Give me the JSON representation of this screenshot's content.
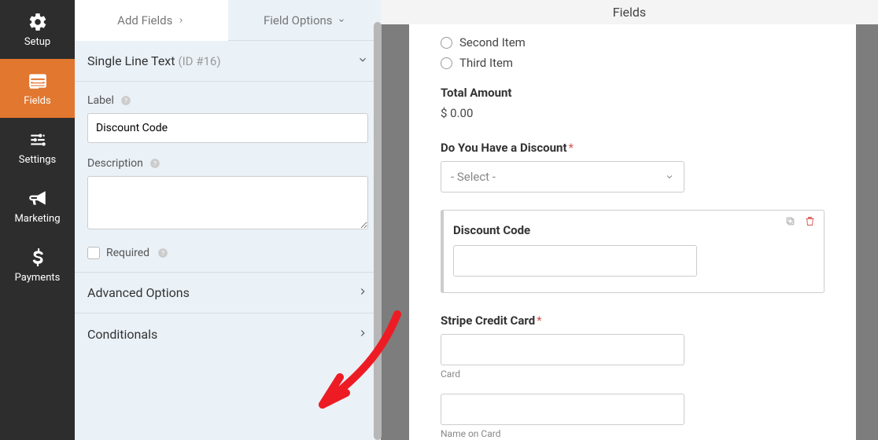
{
  "nav": {
    "setup": "Setup",
    "fields": "Fields",
    "settings": "Settings",
    "marketing": "Marketing",
    "payments": "Payments"
  },
  "tabs": {
    "add": "Add Fields",
    "options": "Field Options"
  },
  "field_header": {
    "title": "Single Line Text",
    "id_suffix": "(ID #16)"
  },
  "labels": {
    "label": "Label",
    "description": "Description",
    "required": "Required"
  },
  "values": {
    "label_value": "Discount Code"
  },
  "accordions": {
    "advanced": "Advanced Options",
    "conditionals": "Conditionals"
  },
  "preview": {
    "header": "Fields",
    "radio2": "Second Item",
    "radio3": "Third Item",
    "total_label": "Total Amount",
    "total_value": "$ 0.00",
    "discount_q": "Do You Have a Discount",
    "select_placeholder": "- Select -",
    "discount_code_title": "Discount Code",
    "stripe_label": "Stripe Credit Card",
    "card_sub": "Card",
    "name_sub": "Name on Card"
  }
}
